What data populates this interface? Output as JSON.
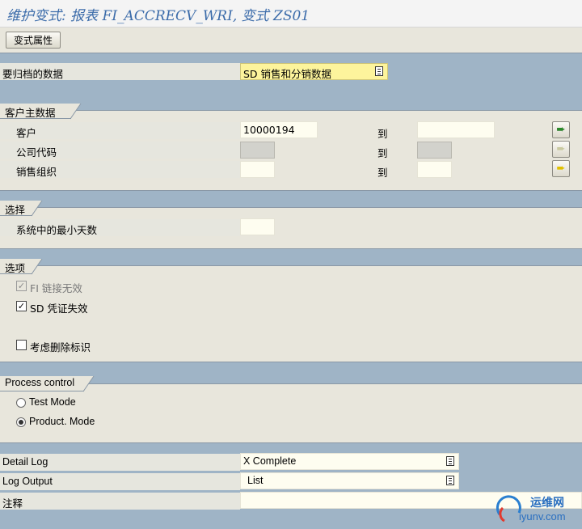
{
  "window": {
    "title": "维护变式: 报表 FI_ACCRECV_WRI, 变式 ZS01"
  },
  "toolbar": {
    "variant_attributes": "变式属性"
  },
  "archive": {
    "label": "要归档的数据",
    "value": "SD 销售和分销数据",
    "value_icon": "list-select-icon"
  },
  "customer_master": {
    "title": "客户主数据",
    "to_label": "到",
    "rows": [
      {
        "label": "客户",
        "from": "10000194",
        "to": "",
        "arrow_state": "active"
      },
      {
        "label": "公司代码",
        "from": "",
        "to": "",
        "arrow_state": "disabled"
      },
      {
        "label": "销售组织",
        "from": "",
        "to": "",
        "arrow_state": "active"
      }
    ]
  },
  "selection": {
    "title": "选择",
    "min_days_label": "系统中的最小天数",
    "min_days_value": ""
  },
  "options": {
    "title": "选项",
    "fi_link_invalid": {
      "label": "FI 链接无效",
      "checked": true,
      "disabled": true
    },
    "sd_doc_invalid": {
      "label": "SD 凭证失效",
      "checked": true,
      "disabled": false
    },
    "consider_deletion_flag": {
      "label": "考虑删除标识",
      "checked": false,
      "disabled": false
    }
  },
  "process_control": {
    "title": "Process control",
    "test_mode": {
      "label": "Test Mode",
      "selected": false
    },
    "product_mode": {
      "label": "Product. Mode",
      "selected": true
    }
  },
  "bottom": {
    "detail_log": {
      "label": "Detail Log",
      "value": "X Complete"
    },
    "log_output": {
      "label": "Log Output",
      "value": "List"
    },
    "note": {
      "label": "注释",
      "value": ""
    }
  },
  "watermark": {
    "text": "运维网",
    "url_text": "iyunv.com"
  }
}
